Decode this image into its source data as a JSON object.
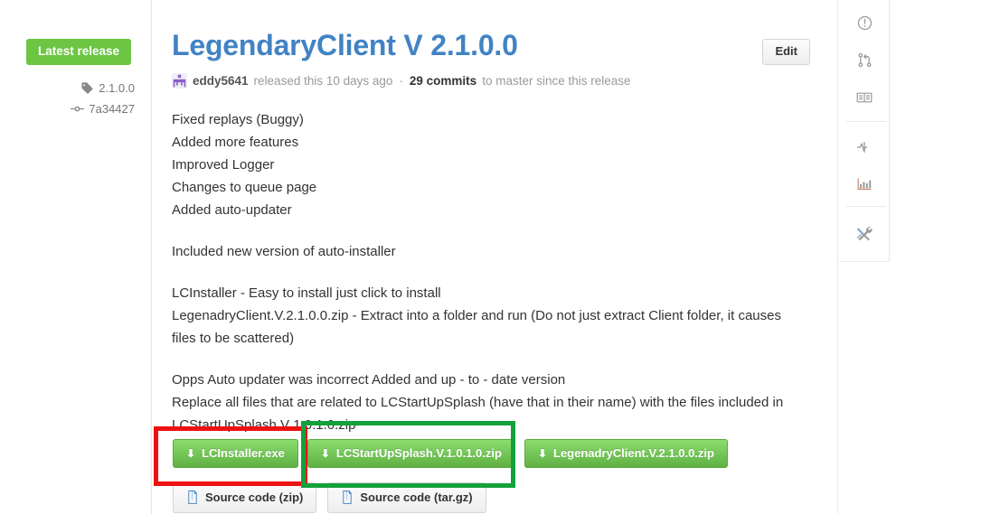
{
  "release": {
    "badge_label": "Latest release",
    "tag_icon": "tag-icon",
    "tag": "2.1.0.0",
    "commit_icon": "commit-icon",
    "commit": "7a34427",
    "title": "LegendaryClient V 2.1.0.0",
    "edit_label": "Edit",
    "byline": {
      "avatar_icon": "avatar-identicon",
      "author": "eddy5641",
      "released_text": "released this 10 days ago",
      "separator": "·",
      "commits_count": "29 commits",
      "commits_suffix": "to master since this release"
    },
    "body_paragraphs": [
      "Fixed replays (Buggy)\nAdded more features\nImproved Logger\nChanges to queue page\nAdded auto-updater",
      "Included new version of auto-installer",
      "LCInstaller - Easy to install just click to install\nLegenadryClient.V.2.1.0.0.zip - Extract into a folder and run (Do not just extract Client folder, it causes files to be scattered)",
      "Opps Auto updater was incorrect Added and up - to - date version\nReplace all files that are related to LCStartUpSplash (have that in their name) with the files included in LCStartUpSplash V 1.0.1.0.zip"
    ],
    "downloads": [
      {
        "icon": "download-arrow-icon",
        "label": "LCInstaller.exe"
      },
      {
        "icon": "download-arrow-icon",
        "label": "LCStartUpSplash.V.1.0.1.0.zip"
      },
      {
        "icon": "download-arrow-icon",
        "label": "LegenadryClient.V.2.1.0.0.zip"
      }
    ],
    "source_links": [
      {
        "icon": "file-zip-icon",
        "label": "Source code (zip)"
      },
      {
        "icon": "file-zip-icon",
        "label": "Source code (tar.gz)"
      }
    ]
  },
  "annotations": [
    {
      "name": "red-highlight-box",
      "color": "#ee1111",
      "target": "LCInstaller.exe"
    },
    {
      "name": "green-highlight-box",
      "color": "#14a03c",
      "target": "LCStartUpSplash.V.1.0.1.0.zip"
    }
  ],
  "icon_rail": {
    "items": [
      {
        "icon": "issue-opened-icon"
      },
      {
        "icon": "git-pull-request-icon"
      },
      {
        "icon": "book-icon"
      },
      {
        "icon": "pulse-icon"
      },
      {
        "icon": "graph-bar-icon"
      },
      {
        "icon": "tools-icon"
      }
    ]
  },
  "colors": {
    "accent_blue": "#4183c4",
    "badge_green": "#6cc644",
    "button_green": "#60b044",
    "annotation_red": "#ee1111",
    "annotation_green": "#14a03c",
    "marker_orange": "#e8700a"
  }
}
